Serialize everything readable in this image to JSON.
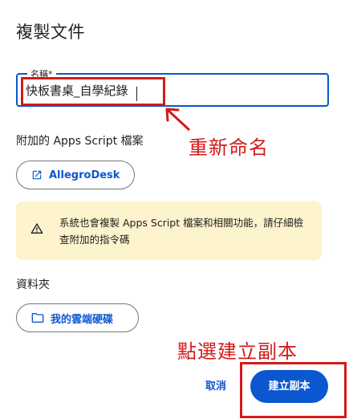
{
  "dialog": {
    "title": "複製文件",
    "name_field": {
      "label": "名稱*",
      "value": "快板書桌_自學紀錄"
    },
    "addon_section": {
      "label": "附加的 Apps Script 檔案",
      "chip_label": "AllegroDesk",
      "chip_icon": "open-in-new-icon"
    },
    "warning": {
      "icon": "warning-icon",
      "text": "系統也會複製 Apps Script 檔案和相關功能，請仔細檢查附加的指令碼",
      "background": "#fdf3cc"
    },
    "folder_section": {
      "label": "資料夾",
      "chip_label": "我的雲端硬碟",
      "chip_icon": "folder-icon"
    },
    "buttons": {
      "cancel": "取消",
      "create": "建立副本"
    }
  },
  "annotations": {
    "rename": "重新命名",
    "click_create": "點選建立副本",
    "color": "#d21b1b"
  },
  "colors": {
    "accent": "#0b57d0"
  }
}
